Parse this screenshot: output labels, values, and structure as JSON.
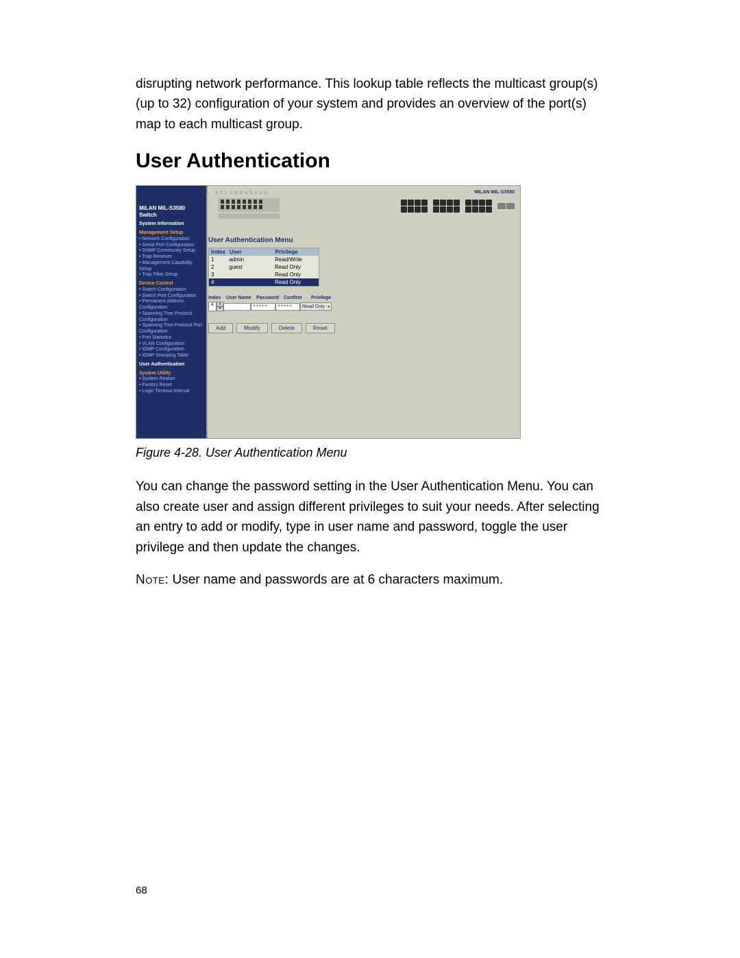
{
  "paragraph_top": "disrupting network performance.  This lookup table reflects the multicast group(s) (up to 32) configuration of your system and provides an overview of the port(s) map to each multicast group.",
  "section_heading": "User Authentication",
  "figure_caption": "Figure 4-28. User Authentication Menu",
  "paragraph_main": "You can change the password setting in the User Authentication Menu.  You can also create user and assign different privileges to suit your needs.  After selecting an entry to add or modify, type in user name and password, toggle the user privilege and then update the changes.",
  "note_label": "Note:",
  "note_text": "  User name and passwords are at 6 characters maximum.",
  "page_number": "68",
  "device_name": "MILAN MIL-S3580",
  "brand_header": "MILAN MIL-S3580",
  "sidebar": {
    "title_top": "MiLAN MIL-S3580 Switch",
    "sections": [
      {
        "label": "System Information",
        "cls": "sec"
      },
      {
        "label": "Management Setup",
        "cls": "sec orange"
      },
      {
        "label": "• Network Configuration",
        "cls": "item"
      },
      {
        "label": "• Serial Port Configuration",
        "cls": "item"
      },
      {
        "label": "• SNMP Community Setup",
        "cls": "item"
      },
      {
        "label": "• Trap Receiver",
        "cls": "item"
      },
      {
        "label": "• Management Capability Setup",
        "cls": "item"
      },
      {
        "label": "• Trap Filter Setup",
        "cls": "item"
      },
      {
        "label": "Device Control",
        "cls": "sec orange"
      },
      {
        "label": "• Switch Configuration",
        "cls": "item"
      },
      {
        "label": "• Switch Port Configuration",
        "cls": "item"
      },
      {
        "label": "• Permanent Address Configuration",
        "cls": "item"
      },
      {
        "label": "• Spanning Tree Protocol Configuration",
        "cls": "item"
      },
      {
        "label": "• Spanning Tree Protocol Port Configuration",
        "cls": "item"
      },
      {
        "label": "• Port Statistics",
        "cls": "item"
      },
      {
        "label": "• VLAN Configuration",
        "cls": "item"
      },
      {
        "label": "• IGMP Configuration",
        "cls": "item"
      },
      {
        "label": "• IGMP Snooping Table",
        "cls": "item"
      },
      {
        "label": "User Authentication",
        "cls": "sec active"
      },
      {
        "label": "System Utility",
        "cls": "sec orange"
      },
      {
        "label": "• System Restart",
        "cls": "item"
      },
      {
        "label": "• Factory Reset",
        "cls": "item"
      },
      {
        "label": "• Login Timeout Interval",
        "cls": "item"
      }
    ]
  },
  "menu": {
    "title": "User Authentication Menu",
    "table": {
      "header": {
        "c1": "Index",
        "c2": "User",
        "c3": "Privilege"
      },
      "rows": [
        {
          "c1": "1",
          "c2": "admin",
          "c3": "Read/Write"
        },
        {
          "c1": "2",
          "c2": "guest",
          "c3": "Read Only"
        },
        {
          "c1": "3",
          "c2": "",
          "c3": "Read Only"
        },
        {
          "c1": "4",
          "c2": "",
          "c3": "Read Only",
          "sel": true
        }
      ]
    },
    "edit": {
      "labels": {
        "l1": "Index",
        "l2": "User Name",
        "l3": "Password",
        "l4": "Confirm",
        "l5": "Privilege"
      },
      "index_value": "4",
      "username_value": "",
      "password_value": "*****",
      "confirm_value": "*****",
      "privilege_value": "Read Only"
    },
    "buttons": {
      "b1": "Add",
      "b2": "Modify",
      "b3": "Delete",
      "b4": "Reset"
    }
  }
}
